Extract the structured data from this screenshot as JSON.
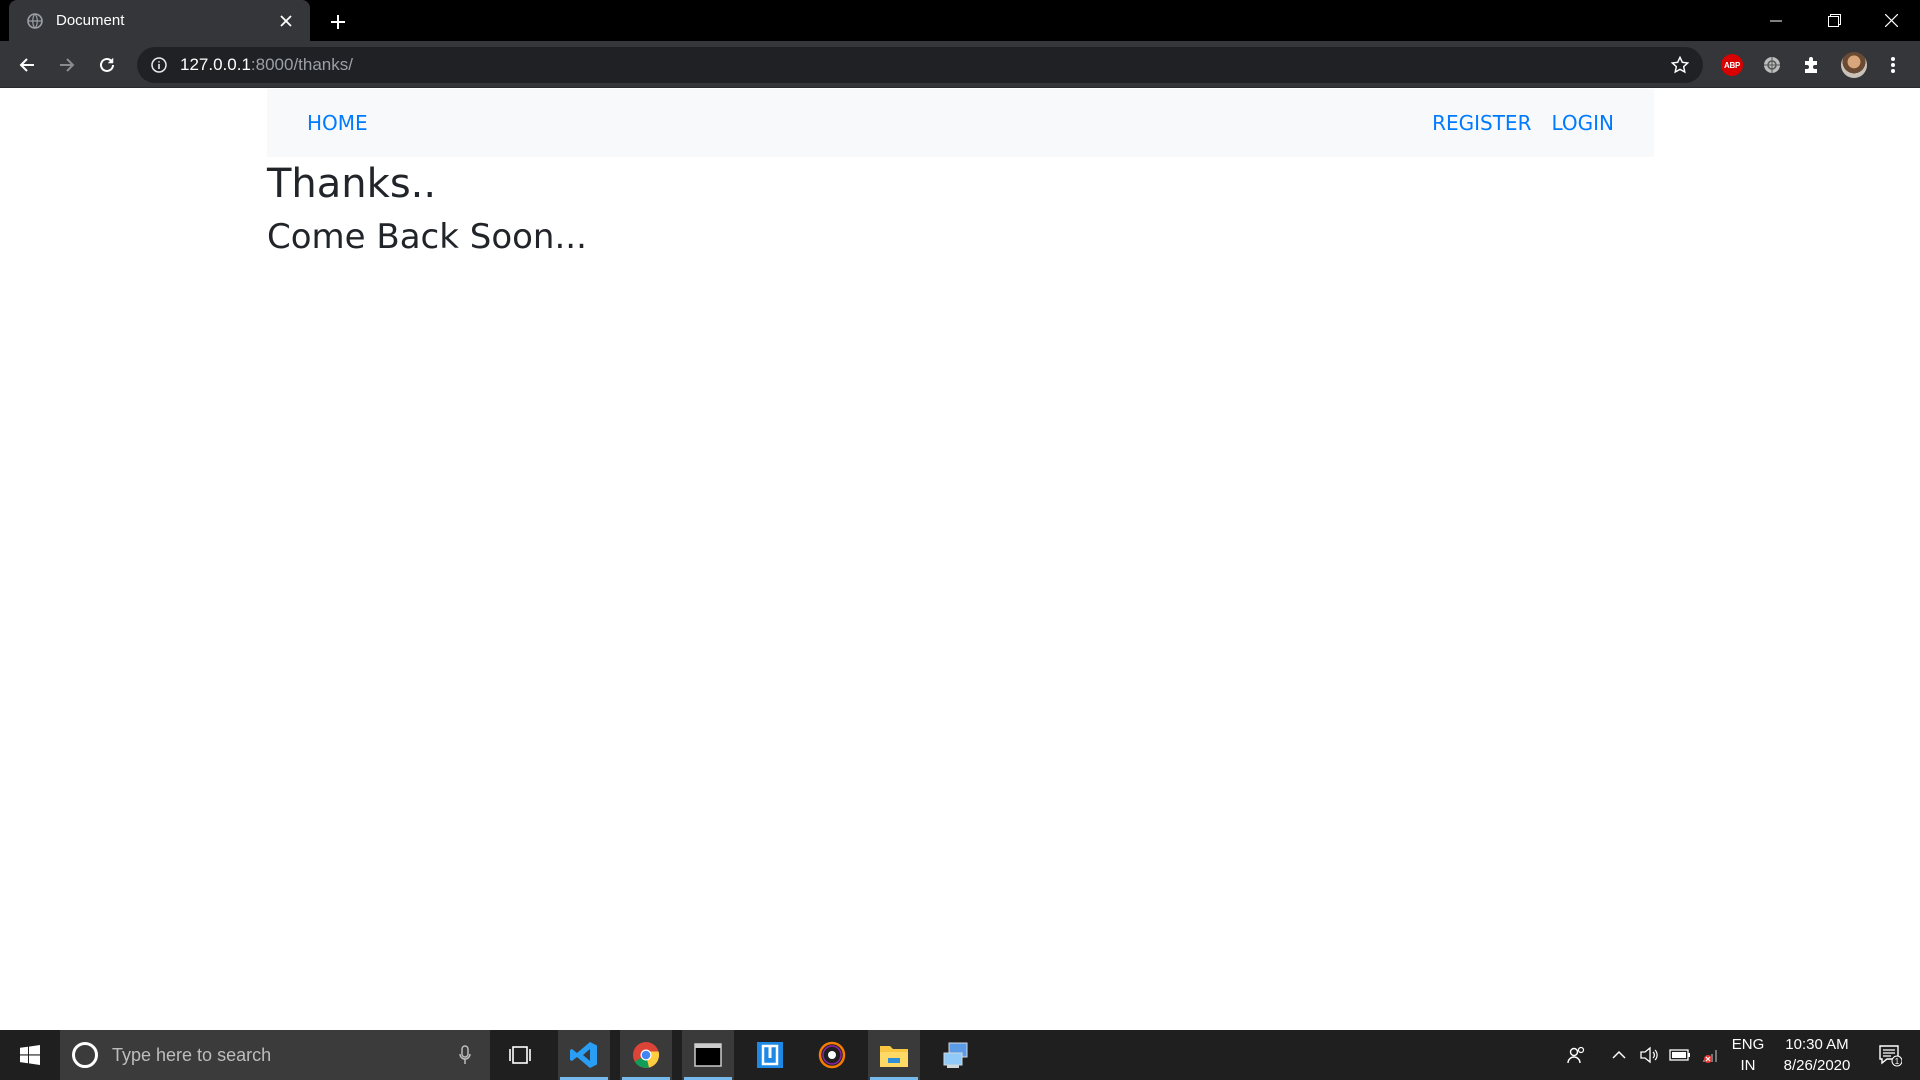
{
  "browser": {
    "tab_title": "Document",
    "url_host": "127.0.0.1",
    "url_path": ":8000/thanks/",
    "icons": [
      "globe-icon",
      "close-icon",
      "plus-icon",
      "minimize-icon",
      "restore-icon",
      "back-icon",
      "forward-icon",
      "reload-icon",
      "info-icon",
      "star-icon",
      "abp-icon",
      "extension-icon",
      "puzzle-icon",
      "kebab-menu-icon"
    ],
    "abp_label": "ABP"
  },
  "navbar": {
    "home": "HOME",
    "register": "REGISTER",
    "login": "LOGIN",
    "link_color": "#007bff",
    "background": "#f8f9fa"
  },
  "content": {
    "heading": "Thanks..",
    "subheading": "Come Back Soon..."
  },
  "taskbar": {
    "search_placeholder": "Type here to search",
    "language_line1": "ENG",
    "language_line2": "IN",
    "time": "10:30 AM",
    "date": "8/26/2020",
    "notification_count": "1",
    "apps": [
      "vscode-icon",
      "chrome-icon",
      "terminal-icon",
      "app-icon",
      "media-icon",
      "file-explorer-icon",
      "network-app-icon"
    ]
  }
}
